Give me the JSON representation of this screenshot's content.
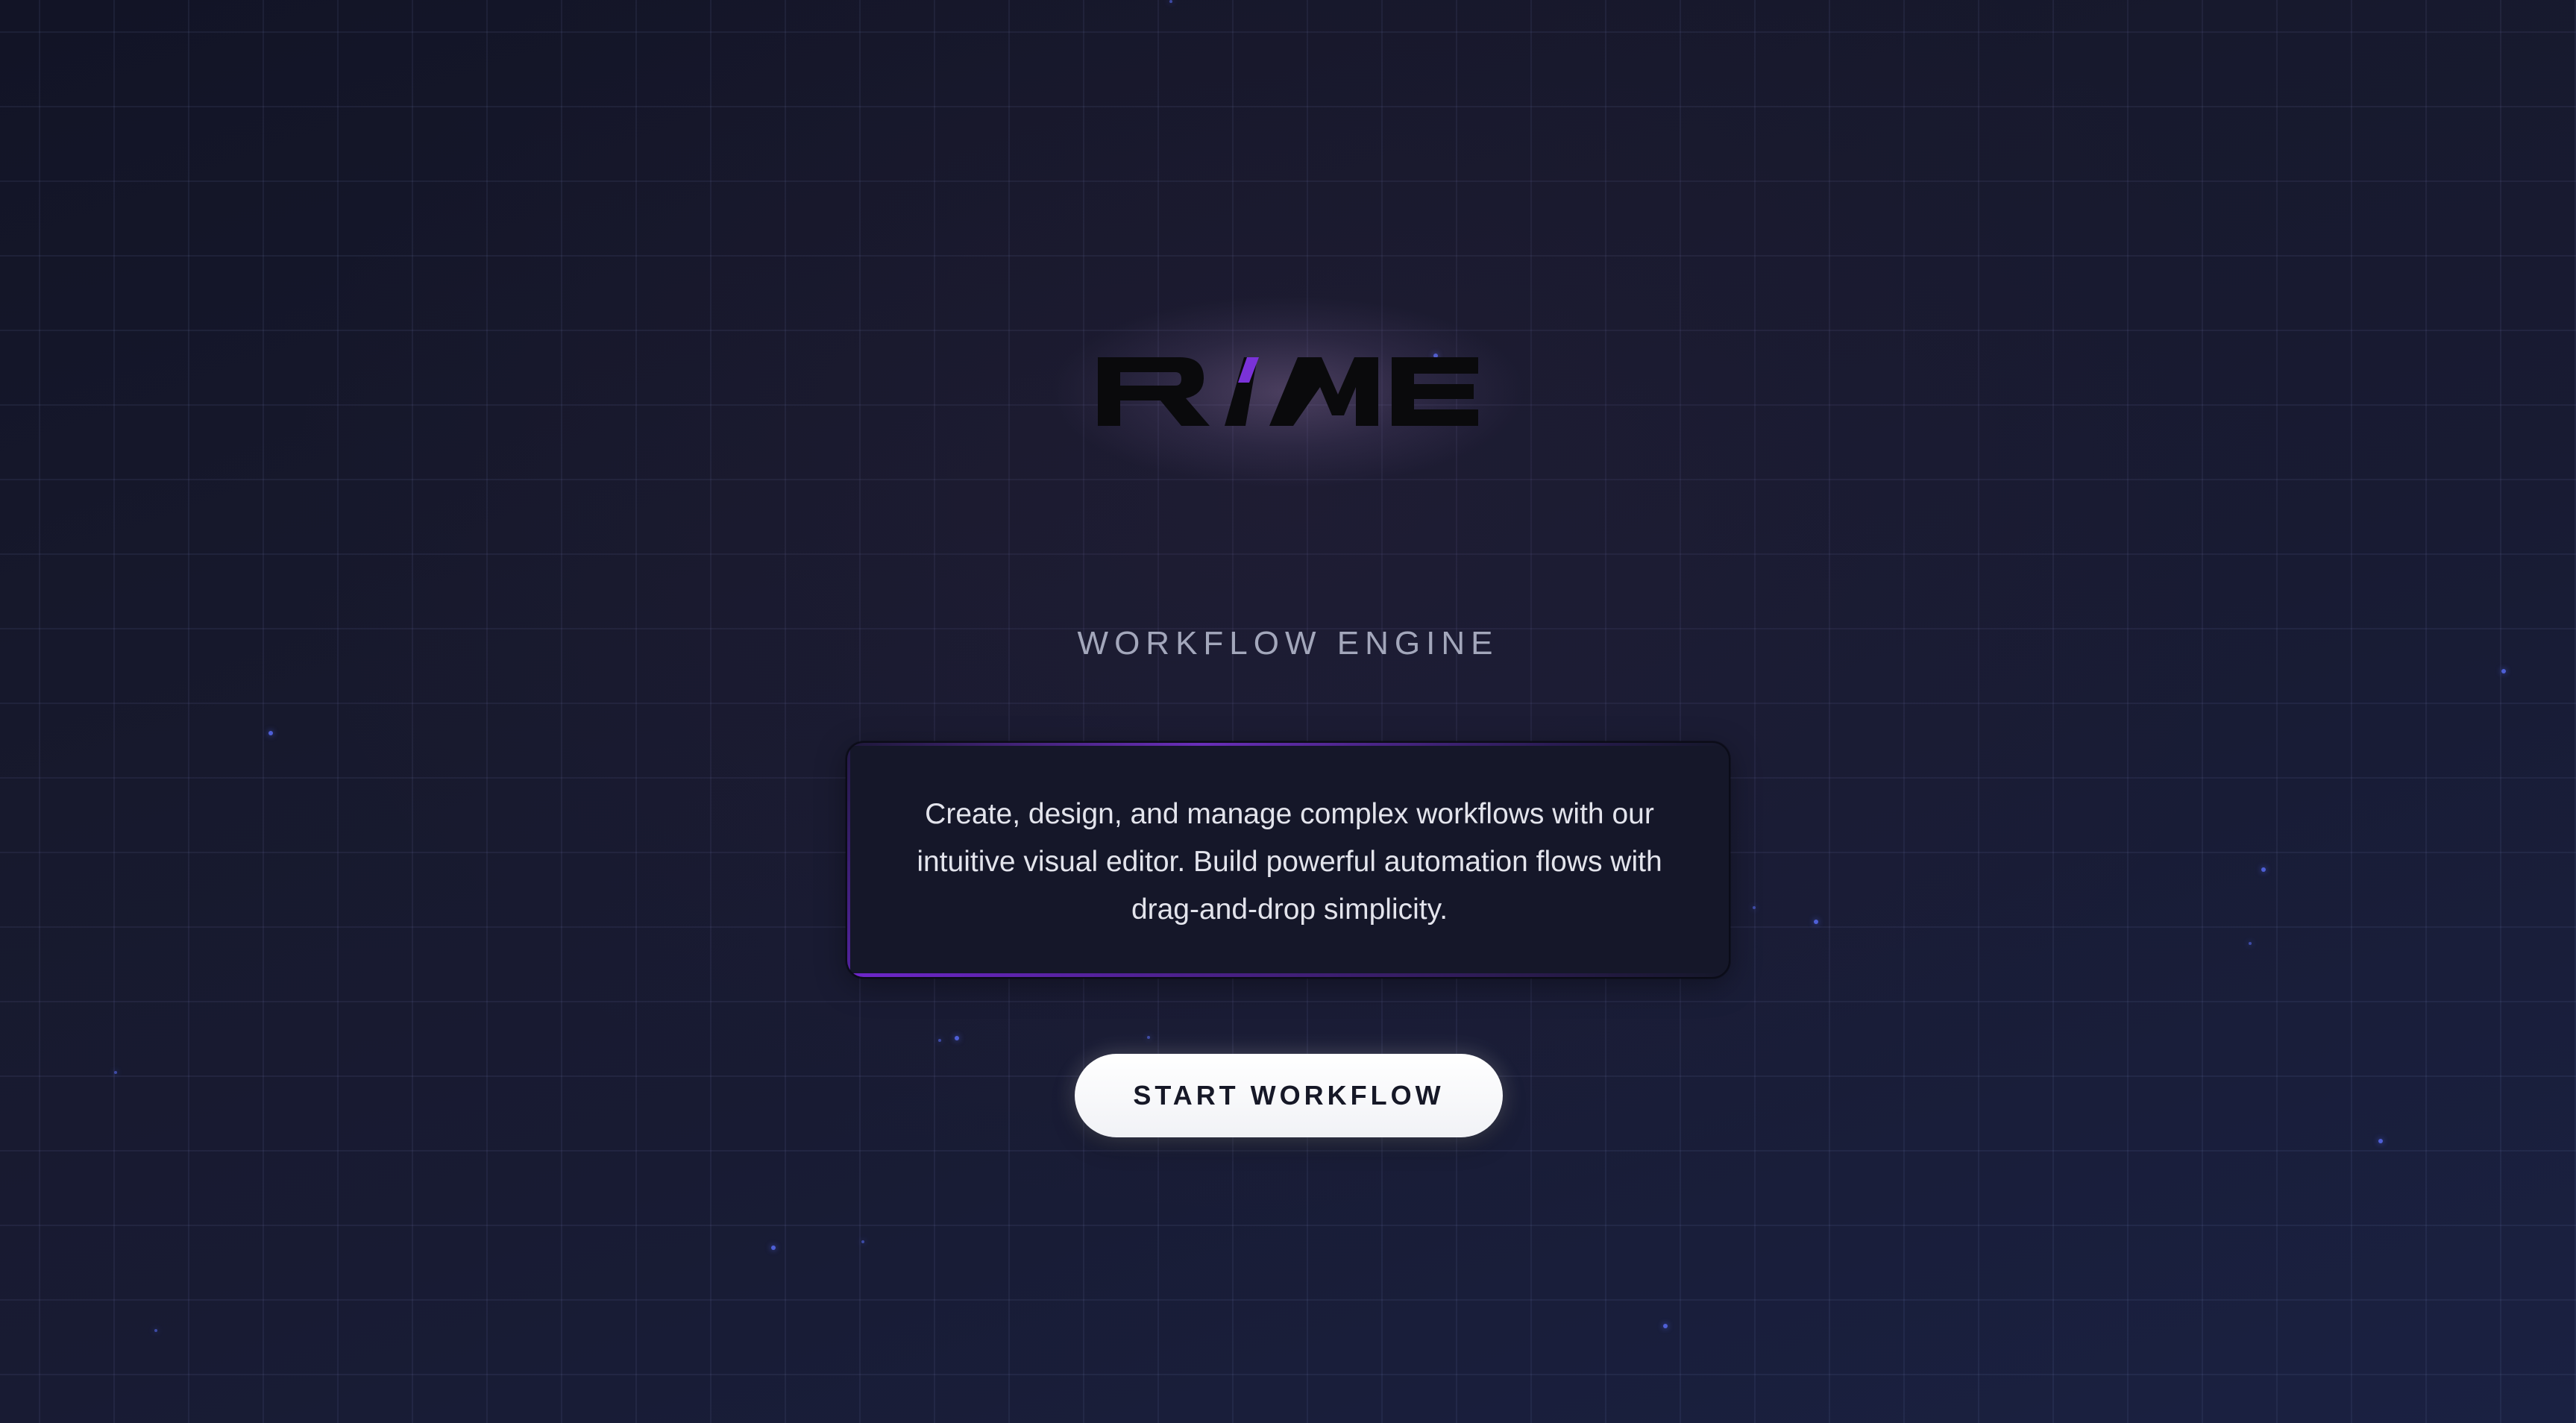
{
  "brand": {
    "logo_text": "RIME",
    "tagline": "WORKFLOW ENGINE"
  },
  "hero": {
    "description": "Create, design, and manage complex workflows with our intuitive visual editor. Build powerful automation flows with drag-and-drop simplicity.",
    "cta_label": "START WORKFLOW"
  },
  "colors": {
    "background": "#161829",
    "grid_line": "#262a45",
    "accent_purple": "#7a32d8",
    "particle_blue": "#4e5fd6",
    "button_bg": "#ffffff",
    "button_text": "#161827"
  },
  "icons": {
    "logo": "rime-wordmark"
  }
}
